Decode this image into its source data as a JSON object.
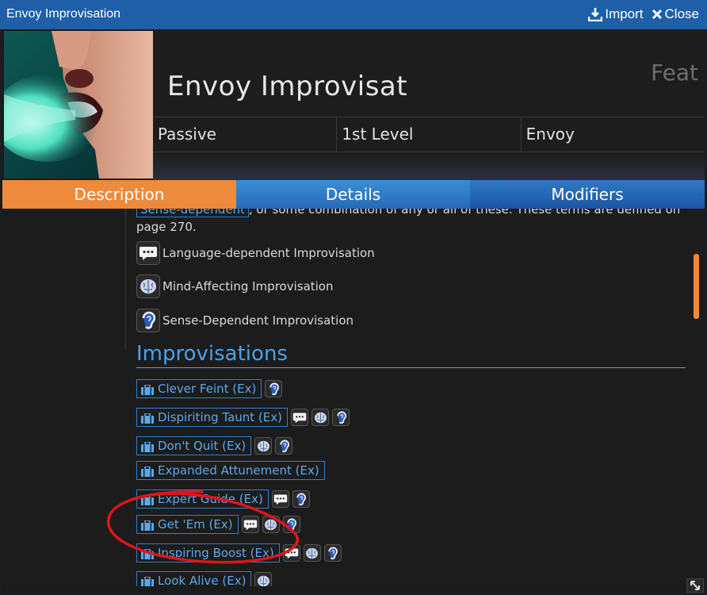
{
  "window": {
    "title": "Envoy Improvisation",
    "import_label": "Import",
    "close_label": "Close"
  },
  "header": {
    "name": "Envoy Improvisat",
    "type": "Feat",
    "cells": [
      "Passive",
      "1st Level",
      "Envoy"
    ]
  },
  "tabs": [
    {
      "label": "Description",
      "active": true
    },
    {
      "label": "Details",
      "active": false
    },
    {
      "label": "Modifiers",
      "active": false
    }
  ],
  "description": {
    "cut_chip": "Sense-dependent",
    "cut_text": ", or some combination of any or all of these. These terms are defined on",
    "page_line": "page 270.",
    "traits": [
      {
        "icon": "speech-bubble-icon",
        "label": "Language-dependent Improvisation"
      },
      {
        "icon": "brain-icon",
        "label": "Mind-Affecting Improvisation"
      },
      {
        "icon": "ear-icon",
        "label": "Sense-Dependent Improvisation"
      }
    ],
    "section_heading": "Improvisations",
    "improvisations": [
      {
        "label": "Clever Feint (Ex)",
        "icons": [
          "ear-icon"
        ]
      },
      {
        "label": "Dispiriting Taunt (Ex)",
        "icons": [
          "speech-bubble-icon",
          "brain-icon",
          "ear-icon"
        ]
      },
      {
        "label": "Don't Quit (Ex)",
        "icons": [
          "brain-icon",
          "ear-icon"
        ]
      },
      {
        "label": "Expanded Attunement (Ex)",
        "icons": []
      },
      {
        "label": "Expert Guide (Ex)",
        "icons": [
          "speech-bubble-icon",
          "ear-icon"
        ]
      },
      {
        "label": "Get 'Em (Ex)",
        "icons": [
          "speech-bubble-icon",
          "brain-icon",
          "ear-icon"
        ]
      },
      {
        "label": "Inspiring Boost (Ex)",
        "icons": [
          "speech-bubble-icon",
          "brain-icon",
          "ear-icon"
        ]
      },
      {
        "label": "Look Alive (Ex)",
        "icons": [
          "brain-icon"
        ]
      }
    ]
  },
  "colors": {
    "title_bar": "#1e5fa8",
    "active_tab": "#ee8a3b",
    "link": "#5aa9ee",
    "annotation": "#e0141a"
  }
}
